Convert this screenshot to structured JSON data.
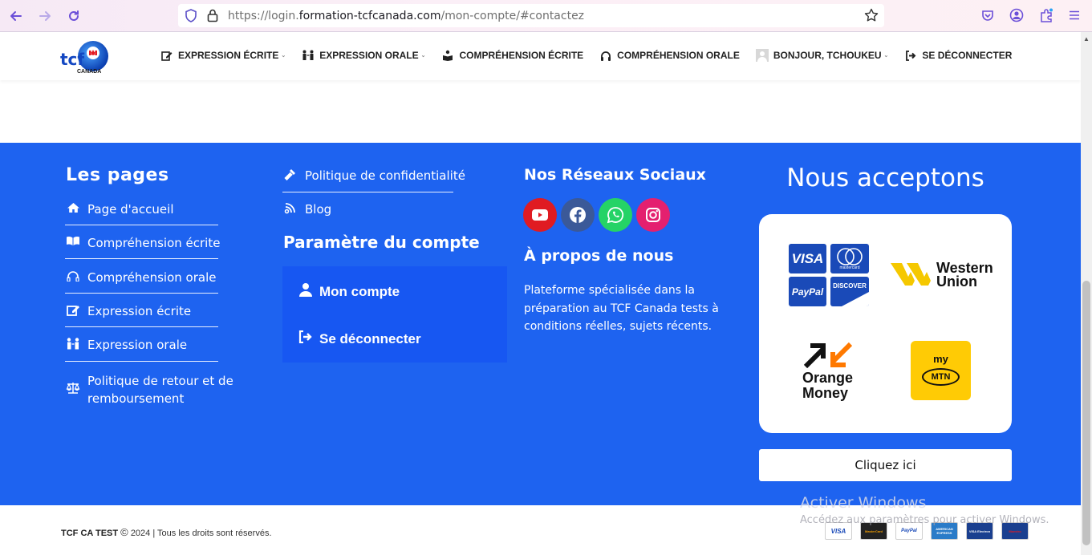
{
  "browser": {
    "url_prefix": "https://login.",
    "url_domain": "formation-tcfcanada.com",
    "url_path": "/mon-compte/#contactez"
  },
  "header": {
    "logo_text": "tcf",
    "logo_sub": "CANADA",
    "menu": [
      {
        "label": "EXPRESSION ÉCRITE",
        "icon": "edit-icon",
        "dropdown": true
      },
      {
        "label": "EXPRESSION ORALE",
        "icon": "people-icon",
        "dropdown": true
      },
      {
        "label": "COMPRÉHENSION ÉCRITE",
        "icon": "reader-icon",
        "dropdown": false
      },
      {
        "label": "COMPRÉHENSION ORALE",
        "icon": "headphones-icon",
        "dropdown": false
      },
      {
        "label": "BONJOUR, TCHOUKEU",
        "icon": "avatar-icon",
        "dropdown": true
      },
      {
        "label": "SE DÉCONNECTER",
        "icon": "logout-icon",
        "dropdown": false
      }
    ]
  },
  "footer": {
    "pages": {
      "title": "Les pages",
      "links": [
        {
          "label": "Page d'accueil",
          "icon": "home-icon"
        },
        {
          "label": "Compréhension écrite",
          "icon": "book-icon"
        },
        {
          "label": "Compréhension orale",
          "icon": "headphones-icon"
        },
        {
          "label": "Expression écrite",
          "icon": "edit-icon"
        },
        {
          "label": "Expression orale",
          "icon": "people-icon"
        },
        {
          "label": "Politique de retour et de",
          "label2": "remboursement",
          "icon": "scale-icon"
        }
      ]
    },
    "col2": {
      "links": [
        {
          "label": "Politique de confidentialité",
          "icon": "gavel-icon"
        },
        {
          "label": "Blog",
          "icon": "blog-icon"
        }
      ],
      "account_title": "Paramètre du compte",
      "account_items": [
        {
          "label": "Mon compte",
          "icon": "user-icon"
        },
        {
          "label": "Se déconnecter",
          "icon": "logout-icon"
        }
      ]
    },
    "social": {
      "title": "Nos Réseaux Sociaux",
      "networks": [
        {
          "name": "youtube-icon",
          "color": "#e01b22"
        },
        {
          "name": "facebook-icon",
          "color": "#3b5998"
        },
        {
          "name": "whatsapp-icon",
          "color": "#25d366"
        },
        {
          "name": "instagram-icon",
          "color": "#e4206f"
        }
      ],
      "about_title": "À propos de nous",
      "about_text_1": "Plateforme spécialisée dans la",
      "about_text_2": "préparation au TCF Canada tests à",
      "about_text_3": "conditions réelles, sujets récents."
    },
    "payments": {
      "title": "Nous acceptons",
      "visa": "VISA",
      "mastercard": "mastercard",
      "paypal": "PayPal",
      "discover": "DISCOVER",
      "western_1": "Western",
      "western_2": "Union",
      "orange_1": "Orange",
      "orange_2": "Money",
      "mtn_1": "my",
      "mtn_2": "MTN",
      "button": "Cliquez ici"
    }
  },
  "bottom": {
    "brand": "TCF CA TEST",
    "copy_symbol": "©",
    "year_text": "2024 | Tous les droits sont réservés.",
    "cards": [
      "VISA",
      "MasterCard",
      "PayPal",
      "AMERICAN EXPRESS",
      "VISA Electron",
      "Maestro"
    ]
  },
  "watermark": {
    "title": "Activer Windows",
    "subtitle": "Accédez aux paramètres pour activer Windows."
  },
  "colors": {
    "footer_blue": "#1e63f0",
    "account_blue": "#1757f2"
  }
}
